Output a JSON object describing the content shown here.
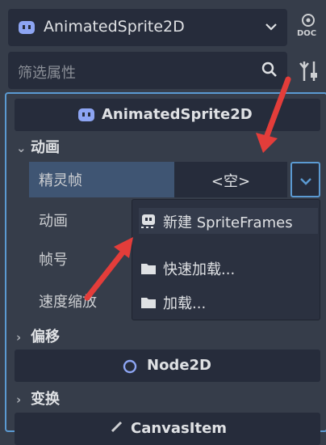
{
  "node_selector": {
    "value": "AnimatedSprite2D"
  },
  "doc_label": "DOC",
  "filter": {
    "placeholder": "筛选属性"
  },
  "inspector": {
    "header": "AnimatedSprite2D",
    "category_animation": "动画",
    "prop_sprite_frames": "精灵帧",
    "sprite_frames_value": "<空>",
    "prop_animation": "动画",
    "prop_frame": "帧号",
    "prop_speed_scale": "速度缩放",
    "category_offset": "偏移",
    "node2d_header": "Node2D",
    "category_transform": "变换",
    "canvas_item_header": "CanvasItem"
  },
  "popup_menu": {
    "items": [
      {
        "label": "新建 SpriteFrames"
      },
      {
        "label": "快速加载..."
      },
      {
        "label": "加载..."
      }
    ]
  },
  "colors": {
    "accent": "#5b9ad2",
    "annotation_arrow": "#e33d3a",
    "node_icon": "#8da5f3"
  }
}
